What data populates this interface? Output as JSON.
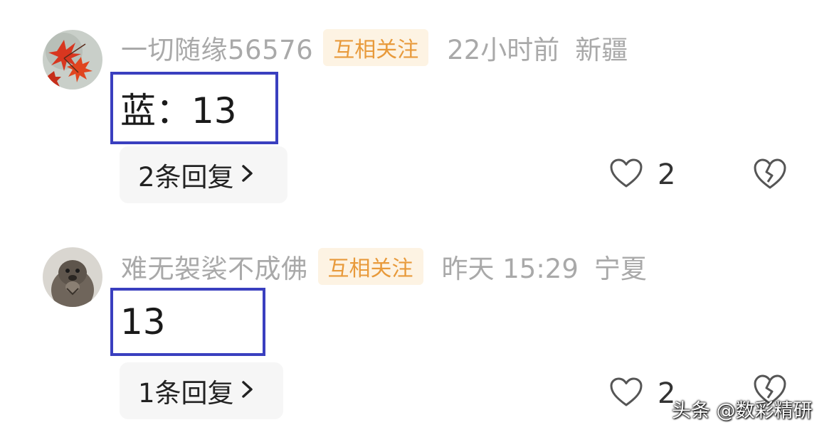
{
  "comments": [
    {
      "username": "一切随缘56576",
      "badge": "互相关注",
      "time": "22小时前",
      "location": "新疆",
      "content": "蓝：13",
      "replies_label": "2条回复",
      "likes": "2",
      "avatar": "red-maple-leaves-avatar"
    },
    {
      "username": "难无袈裟不成佛",
      "badge": "互相关注",
      "time": "昨天 15:29",
      "location": "宁夏",
      "content": "13",
      "replies_label": "1条回复",
      "likes": "2",
      "avatar": "otter-avatar"
    }
  ],
  "icons": {
    "chevron": "chevron-right-icon",
    "like": "heart-icon",
    "dislike": "broken-heart-icon"
  },
  "colors": {
    "highlight_border": "#3a3fbf",
    "badge_text": "#e89a3b",
    "badge_bg": "#fdf3e3",
    "meta_text": "#a9a9a9"
  },
  "watermark": "头条 @数彩精研"
}
